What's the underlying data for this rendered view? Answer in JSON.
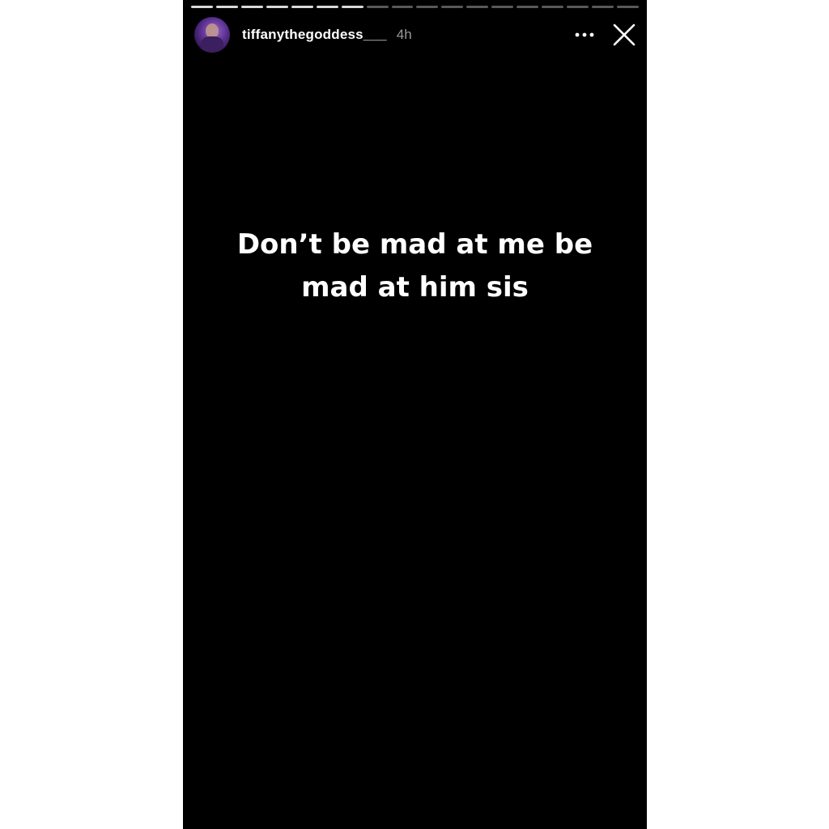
{
  "story": {
    "progress": {
      "segments_total": 18,
      "segments_viewed": 7
    },
    "header": {
      "avatar_icon": "profile-avatar",
      "username": "tiffanythegoddess___",
      "time_ago": "4h",
      "more_icon": "more-horizontal-icon",
      "close_icon": "close-icon"
    },
    "caption": {
      "line1": "Don’t be mad at me be",
      "line2": "mad at him sis"
    },
    "colors": {
      "background": "#000000",
      "text": "#ffffff",
      "page": "#ffffff"
    }
  }
}
